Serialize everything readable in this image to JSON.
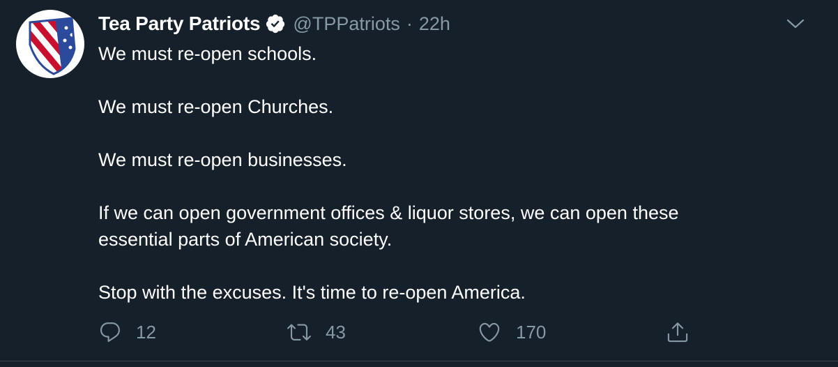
{
  "tweet": {
    "display_name": "Tea Party Patriots",
    "handle": "@TPPatriots",
    "separator": "·",
    "time": "22h",
    "lines": {
      "l1": "We must re-open schools.",
      "l2": "We must re-open Churches.",
      "l3": "We must re-open businesses.",
      "l4a": "If we can open government offices & liquor stores, we can open these",
      "l4b": "essential parts of American society.",
      "l5": "Stop with the excuses. It's time to re-open America."
    },
    "actions": {
      "reply_count": "12",
      "retweet_count": "43",
      "like_count": "170"
    }
  },
  "icons": {
    "avatar": "tea-party-patriots-shield-logo",
    "verified": "verified-badge-icon",
    "caret": "chevron-down-icon",
    "reply": "reply-icon",
    "retweet": "retweet-icon",
    "like": "heart-icon",
    "share": "share-icon"
  },
  "colors": {
    "background": "#15202b",
    "muted_text": "#8899a6",
    "text": "#ffffff"
  }
}
